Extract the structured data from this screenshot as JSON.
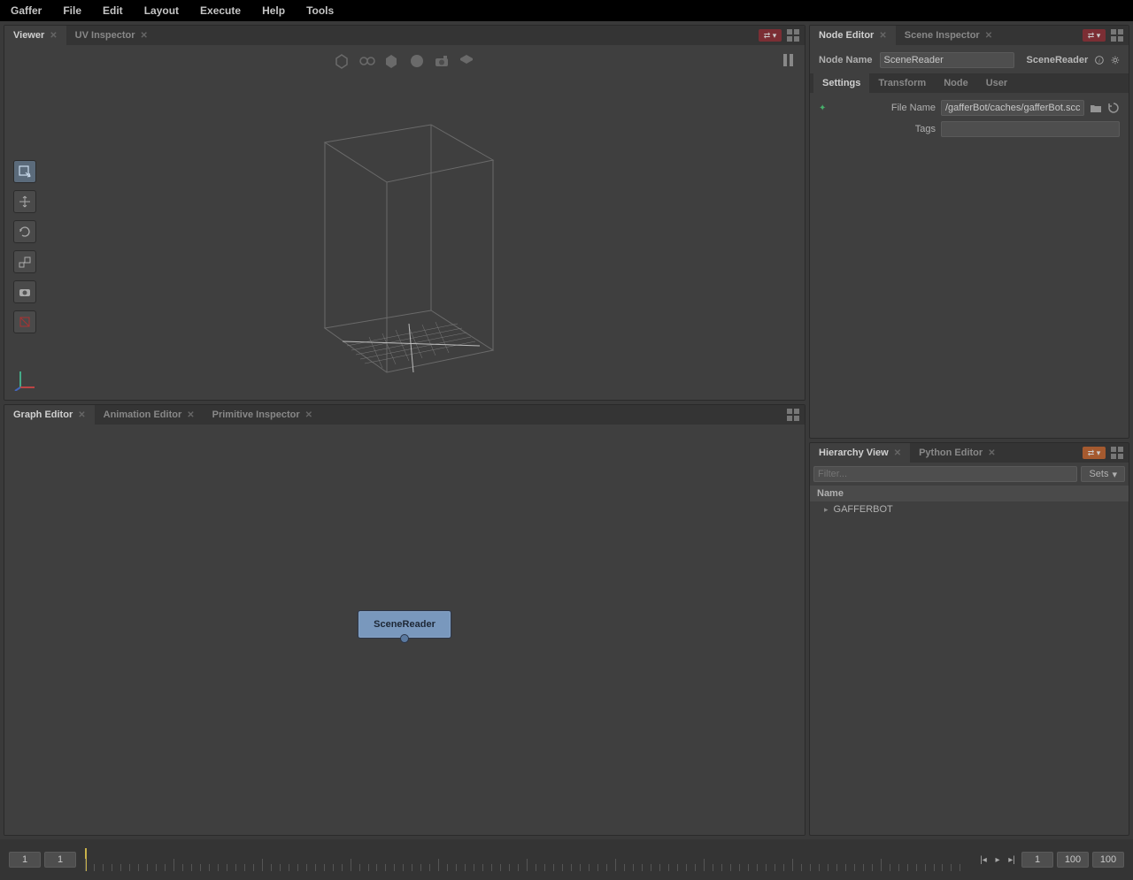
{
  "menu": {
    "items": [
      "Gaffer",
      "File",
      "Edit",
      "Layout",
      "Execute",
      "Help",
      "Tools"
    ]
  },
  "panels": {
    "viewer": {
      "title": "Viewer"
    },
    "uv_inspector": {
      "title": "UV Inspector"
    },
    "graph_editor": {
      "title": "Graph Editor"
    },
    "animation_editor": {
      "title": "Animation Editor"
    },
    "primitive_inspector": {
      "title": "Primitive Inspector"
    },
    "node_editor": {
      "title": "Node Editor"
    },
    "scene_inspector": {
      "title": "Scene Inspector"
    },
    "hierarchy_view": {
      "title": "Hierarchy View"
    },
    "python_editor": {
      "title": "Python Editor"
    }
  },
  "node_editor": {
    "node_name_label": "Node Name",
    "node_name_value": "SceneReader",
    "node_type": "SceneReader",
    "tabs": [
      "Settings",
      "Transform",
      "Node",
      "User"
    ],
    "file_name_label": "File Name",
    "file_name_value": "/gafferBot/caches/gafferBot.scc",
    "tags_label": "Tags",
    "tags_value": ""
  },
  "hierarchy": {
    "filter_placeholder": "Filter...",
    "sets_label": "Sets",
    "name_header": "Name",
    "root_item": "GAFFERBOT"
  },
  "graph": {
    "node_label": "SceneReader"
  },
  "timeline": {
    "start": "1",
    "current": "1",
    "end_current": "1",
    "range_end": "100",
    "range_display": "100"
  }
}
